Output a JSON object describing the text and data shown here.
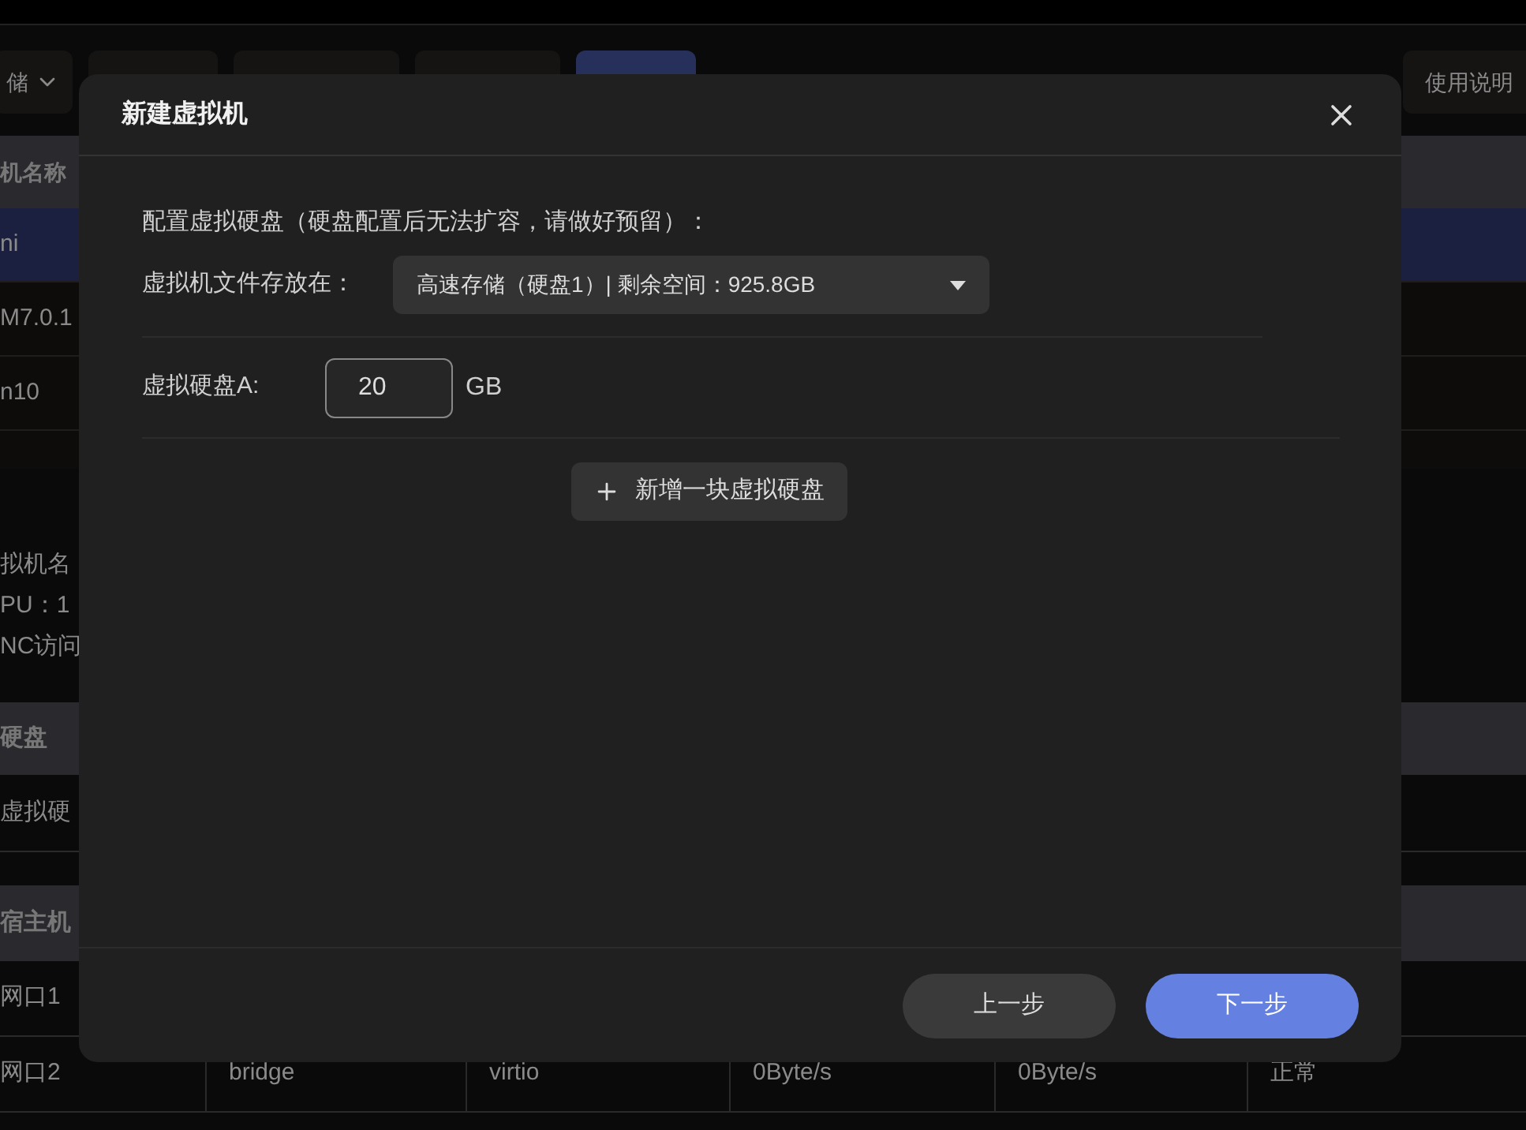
{
  "toolbar": {
    "dropdown_label": "储",
    "help_button": "使用说明"
  },
  "vm_table": {
    "header": "机名称",
    "rows": [
      {
        "name": "ni",
        "selected": true
      },
      {
        "name": "M7.0.1",
        "selected": false
      },
      {
        "name": "n10",
        "selected": false
      }
    ]
  },
  "details": [
    "拟机名",
    "PU：1",
    "NC访问"
  ],
  "disk_table": {
    "header": "硬盘",
    "rows": [
      "虚拟硬"
    ]
  },
  "network_table": {
    "header": "宿主机",
    "rows": [
      [
        "网口1"
      ],
      [
        "网口2",
        "bridge",
        "virtio",
        "0Byte/s",
        "0Byte/s",
        "正常"
      ]
    ]
  },
  "dialog": {
    "title": "新建虚拟机",
    "section_title": "配置虚拟硬盘（硬盘配置后无法扩容，请做好预留）：",
    "storage": {
      "label": "虚拟机文件存放在：",
      "value": "高速存储（硬盘1）| 剩余空间：925.8GB"
    },
    "disks": [
      {
        "label": "虚拟硬盘A:",
        "value": "20",
        "unit": "GB"
      }
    ],
    "add_disk_button": "新增一块虚拟硬盘",
    "back_button": "上一步",
    "next_button": "下一步"
  }
}
